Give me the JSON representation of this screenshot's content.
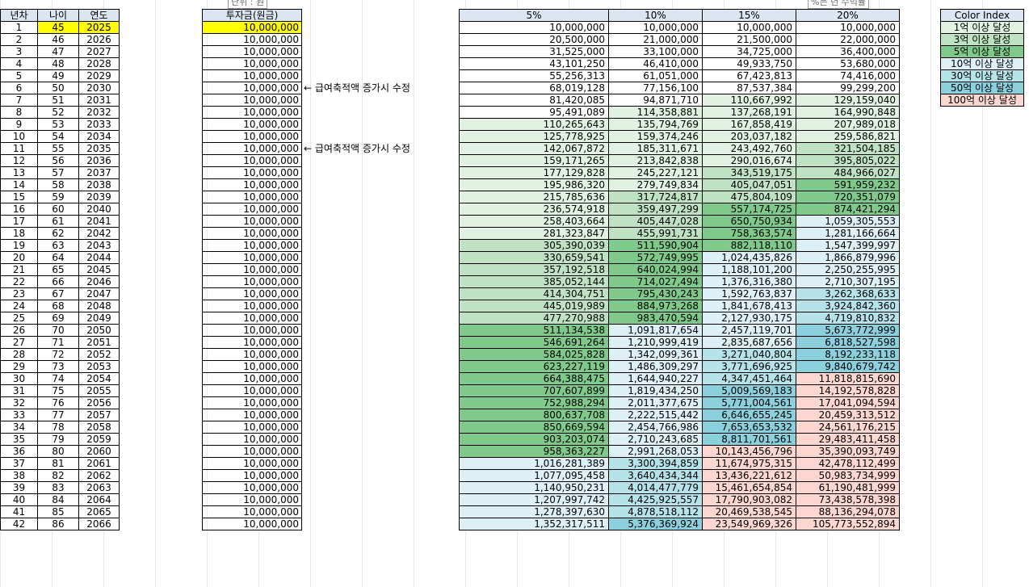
{
  "left_table": {
    "headers": [
      "년차",
      "나이",
      "연도"
    ],
    "rows": [
      [
        "1",
        "45",
        "2025"
      ],
      [
        "2",
        "46",
        "2026"
      ],
      [
        "3",
        "47",
        "2027"
      ],
      [
        "4",
        "48",
        "2028"
      ],
      [
        "5",
        "49",
        "2029"
      ],
      [
        "6",
        "50",
        "2030"
      ],
      [
        "7",
        "51",
        "2031"
      ],
      [
        "8",
        "52",
        "2032"
      ],
      [
        "9",
        "53",
        "2033"
      ],
      [
        "10",
        "54",
        "2034"
      ],
      [
        "11",
        "55",
        "2035"
      ],
      [
        "12",
        "56",
        "2036"
      ],
      [
        "13",
        "57",
        "2037"
      ],
      [
        "14",
        "58",
        "2038"
      ],
      [
        "15",
        "59",
        "2039"
      ],
      [
        "16",
        "60",
        "2040"
      ],
      [
        "17",
        "61",
        "2041"
      ],
      [
        "18",
        "62",
        "2042"
      ],
      [
        "19",
        "63",
        "2043"
      ],
      [
        "20",
        "64",
        "2044"
      ],
      [
        "21",
        "65",
        "2045"
      ],
      [
        "22",
        "66",
        "2046"
      ],
      [
        "23",
        "67",
        "2047"
      ],
      [
        "24",
        "68",
        "2048"
      ],
      [
        "25",
        "69",
        "2049"
      ],
      [
        "26",
        "70",
        "2050"
      ],
      [
        "27",
        "71",
        "2051"
      ],
      [
        "28",
        "72",
        "2052"
      ],
      [
        "29",
        "73",
        "2053"
      ],
      [
        "30",
        "74",
        "2054"
      ],
      [
        "31",
        "75",
        "2055"
      ],
      [
        "32",
        "76",
        "2056"
      ],
      [
        "33",
        "77",
        "2057"
      ],
      [
        "34",
        "78",
        "2058"
      ],
      [
        "35",
        "79",
        "2059"
      ],
      [
        "36",
        "80",
        "2060"
      ],
      [
        "37",
        "81",
        "2061"
      ],
      [
        "38",
        "82",
        "2062"
      ],
      [
        "39",
        "83",
        "2063"
      ],
      [
        "40",
        "84",
        "2064"
      ],
      [
        "41",
        "85",
        "2065"
      ],
      [
        "42",
        "86",
        "2066"
      ]
    ]
  },
  "unit_label": "단위 : 원",
  "rate_note": "%는 년 수익률",
  "investment": {
    "header": "투자금(원금)",
    "value": "10,000,000",
    "row_count": 42
  },
  "notes": [
    {
      "row": 6,
      "text": "← 급여축적액 증가시 수정"
    },
    {
      "row": 11,
      "text": "← 급여축적액 증가시 수정"
    }
  ],
  "colors": {
    "highlight_yellow": "#ffff00",
    "header_bg": "#dbe6f1",
    "green1": "#e2f2e2",
    "green3": "#bfe3c2",
    "green5": "#7fc98a",
    "blue10": "#dcf0f6",
    "blue30": "#b6e2ea",
    "blue50": "#8cd0de",
    "red100": "#fbd7cf"
  },
  "legend": {
    "title": "Color Index",
    "items": [
      {
        "label": "1억 이상 달성",
        "color": "#e2f2e2"
      },
      {
        "label": "3억 이상 달성",
        "color": "#bfe3c2"
      },
      {
        "label": "5억 이상 달성",
        "color": "#7fc98a"
      },
      {
        "label": "10억 이상 달성",
        "color": "#dcf0f6"
      },
      {
        "label": "30억 이상 달성",
        "color": "#b6e2ea"
      },
      {
        "label": "50억 이상 달성",
        "color": "#8cd0de"
      },
      {
        "label": "100억 이상 달성",
        "color": "#fbd7cf"
      }
    ]
  },
  "projection": {
    "headers": [
      "5%",
      "10%",
      "15%",
      "20%"
    ],
    "rows": [
      [
        "10,000,000",
        "10,000,000",
        "10,000,000",
        "10,000,000"
      ],
      [
        "20,500,000",
        "21,000,000",
        "21,500,000",
        "22,000,000"
      ],
      [
        "31,525,000",
        "33,100,000",
        "34,725,000",
        "36,400,000"
      ],
      [
        "43,101,250",
        "46,410,000",
        "49,933,750",
        "53,680,000"
      ],
      [
        "55,256,313",
        "61,051,000",
        "67,423,813",
        "74,416,000"
      ],
      [
        "68,019,128",
        "77,156,100",
        "87,537,384",
        "99,299,200"
      ],
      [
        "81,420,085",
        "94,871,710",
        "110,667,992",
        "129,159,040"
      ],
      [
        "95,491,089",
        "114,358,881",
        "137,268,191",
        "164,990,848"
      ],
      [
        "110,265,643",
        "135,794,769",
        "167,858,419",
        "207,989,018"
      ],
      [
        "125,778,925",
        "159,374,246",
        "203,037,182",
        "259,586,821"
      ],
      [
        "142,067,872",
        "185,311,671",
        "243,492,760",
        "321,504,185"
      ],
      [
        "159,171,265",
        "213,842,838",
        "290,016,674",
        "395,805,022"
      ],
      [
        "177,129,828",
        "245,227,121",
        "343,519,175",
        "484,966,027"
      ],
      [
        "195,986,320",
        "279,749,834",
        "405,047,051",
        "591,959,232"
      ],
      [
        "215,785,636",
        "317,724,817",
        "475,804,109",
        "720,351,079"
      ],
      [
        "236,574,918",
        "359,497,299",
        "557,174,725",
        "874,421,294"
      ],
      [
        "258,403,664",
        "405,447,028",
        "650,750,934",
        "1,059,305,553"
      ],
      [
        "281,323,847",
        "455,991,731",
        "758,363,574",
        "1,281,166,664"
      ],
      [
        "305,390,039",
        "511,590,904",
        "882,118,110",
        "1,547,399,997"
      ],
      [
        "330,659,541",
        "572,749,995",
        "1,024,435,826",
        "1,866,879,996"
      ],
      [
        "357,192,518",
        "640,024,994",
        "1,188,101,200",
        "2,250,255,995"
      ],
      [
        "385,052,144",
        "714,027,494",
        "1,376,316,380",
        "2,710,307,195"
      ],
      [
        "414,304,751",
        "795,430,243",
        "1,592,763,837",
        "3,262,368,633"
      ],
      [
        "445,019,989",
        "884,973,268",
        "1,841,678,413",
        "3,924,842,360"
      ],
      [
        "477,270,988",
        "983,470,594",
        "2,127,930,175",
        "4,719,810,832"
      ],
      [
        "511,134,538",
        "1,091,817,654",
        "2,457,119,701",
        "5,673,772,999"
      ],
      [
        "546,691,264",
        "1,210,999,419",
        "2,835,687,656",
        "6,818,527,598"
      ],
      [
        "584,025,828",
        "1,342,099,361",
        "3,271,040,804",
        "8,192,233,118"
      ],
      [
        "623,227,119",
        "1,486,309,297",
        "3,771,696,925",
        "9,840,679,742"
      ],
      [
        "664,388,475",
        "1,644,940,227",
        "4,347,451,464",
        "11,818,815,690"
      ],
      [
        "707,607,899",
        "1,819,434,250",
        "5,009,569,183",
        "14,192,578,828"
      ],
      [
        "752,988,294",
        "2,011,377,675",
        "5,771,004,561",
        "17,041,094,594"
      ],
      [
        "800,637,708",
        "2,222,515,442",
        "6,646,655,245",
        "20,459,313,512"
      ],
      [
        "850,669,594",
        "2,454,766,986",
        "7,653,653,532",
        "24,561,176,215"
      ],
      [
        "903,203,074",
        "2,710,243,685",
        "8,811,701,561",
        "29,483,411,458"
      ],
      [
        "958,363,227",
        "2,991,268,053",
        "10,143,456,796",
        "35,390,093,749"
      ],
      [
        "1,016,281,389",
        "3,300,394,859",
        "11,674,975,315",
        "42,478,112,499"
      ],
      [
        "1,077,095,458",
        "3,640,434,344",
        "13,436,221,612",
        "50,983,734,999"
      ],
      [
        "1,140,950,231",
        "4,014,477,779",
        "15,461,654,854",
        "61,190,481,999"
      ],
      [
        "1,207,997,742",
        "4,425,925,557",
        "17,790,903,082",
        "73,438,578,398"
      ],
      [
        "1,278,397,630",
        "4,878,518,112",
        "20,469,538,545",
        "88,136,294,078"
      ],
      [
        "1,352,317,511",
        "5,376,369,924",
        "23,549,969,326",
        "105,773,552,894"
      ]
    ]
  }
}
